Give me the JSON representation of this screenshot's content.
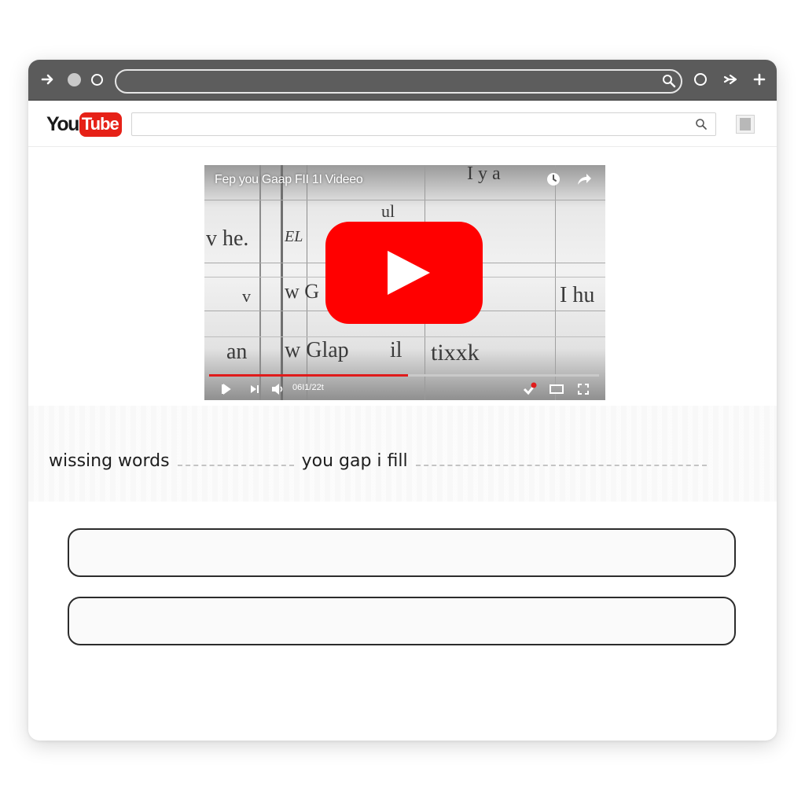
{
  "browser": {
    "icons": [
      "forward-arrow-icon",
      "record-dot-icon",
      "reload-circle-icon",
      "search-icon",
      "refresh-circle-icon",
      "share-forward-icon",
      "plus-icon"
    ],
    "address_value": ""
  },
  "youtube": {
    "logo": {
      "you": "You",
      "tube": "Tube"
    },
    "search_value": "",
    "brand_color": "#e62117"
  },
  "video": {
    "title": "Fep you Gaap FII 1I Videeo",
    "time": "06I1/22t",
    "progress_fraction": 0.51,
    "accent_color": "#ff0000",
    "scene_text": [
      "I y a",
      "v he.",
      "EL",
      "ul",
      "v",
      "w G",
      "I hu",
      "an",
      "w Glap",
      "il",
      "tixxk"
    ],
    "controls": [
      "play-icon",
      "next-icon",
      "volume-icon",
      "settings-icon",
      "theater-icon",
      "fullscreen-icon"
    ],
    "top_icons": [
      "watch-later-icon",
      "share-icon"
    ]
  },
  "exercise": {
    "part1": "wissing words",
    "part2": "you gap i fill",
    "answers": [
      "",
      ""
    ]
  }
}
